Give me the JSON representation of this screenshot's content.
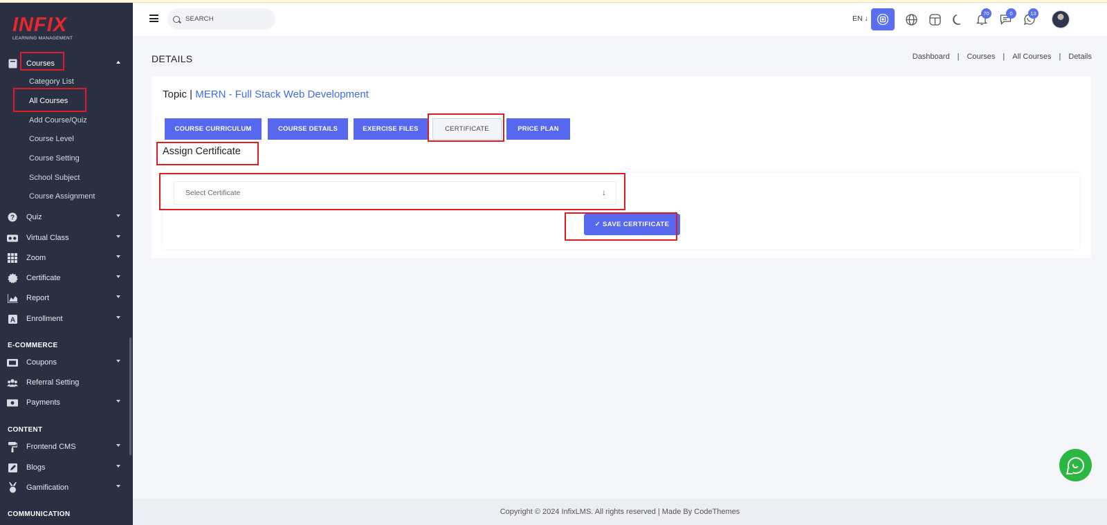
{
  "brand": {
    "logo_text": "INFIX",
    "logo_sub": "LEARNING MANAGEMENT"
  },
  "sidebar": {
    "courses": {
      "label": "Courses",
      "icon": "book-icon"
    },
    "sub_items": [
      "Category List",
      "All Courses",
      "Add Course/Quiz",
      "Course Level",
      "Course Setting",
      "School Subject",
      "Course Assignment"
    ],
    "items": [
      {
        "label": "Quiz",
        "icon": "question-circle-icon"
      },
      {
        "label": "Virtual Class",
        "icon": "vr-headset-icon"
      },
      {
        "label": "Zoom",
        "icon": "grid-icon"
      },
      {
        "label": "Certificate",
        "icon": "certificate-icon"
      },
      {
        "label": "Report",
        "icon": "area-chart-icon"
      },
      {
        "label": "Enrollment",
        "icon": "enrollment-icon"
      }
    ],
    "sections": {
      "ecommerce": "E-COMMERCE",
      "content": "CONTENT",
      "communication": "COMMUNICATION"
    },
    "ecommerce_items": [
      {
        "label": "Coupons",
        "icon": "ticket-icon"
      },
      {
        "label": "Referral Setting",
        "icon": "users-icon"
      },
      {
        "label": "Payments",
        "icon": "money-icon"
      }
    ],
    "content_items": [
      {
        "label": "Frontend CMS",
        "icon": "paint-roller-icon"
      },
      {
        "label": "Blogs",
        "icon": "edit-icon"
      },
      {
        "label": "Gamification",
        "icon": "medal-icon"
      }
    ]
  },
  "topbar": {
    "search_placeholder": "SEARCH",
    "language": "EN ↓",
    "badges": {
      "notifications": "70",
      "messages": "0",
      "whatsapp": "13"
    }
  },
  "page": {
    "title": "DETAILS",
    "breadcrumb": [
      "Dashboard",
      "Courses",
      "All Courses",
      "Details"
    ],
    "topic_prefix": "Topic |",
    "topic_name": "MERN - Full Stack Web Development",
    "tabs": [
      "COURSE CURRICULUM",
      "COURSE DETAILS",
      "EXERCISE FILES",
      "CERTIFICATE",
      "PRICE PLAN"
    ],
    "active_tab": "CERTIFICATE",
    "assign_heading": "Assign Certificate",
    "select_placeholder": "Select Certificate",
    "save_button": "✓  SAVE CERTIFICATE"
  },
  "footer": {
    "text": "Copyright © 2024 InfixLMS. All rights reserved | Made By CodeThemes"
  },
  "colors": {
    "sidebar_bg": "#2a3042",
    "accent": "#5568ee",
    "highlight": "#e11b22",
    "whatsapp": "#2bb741",
    "link": "#3d6be8"
  }
}
